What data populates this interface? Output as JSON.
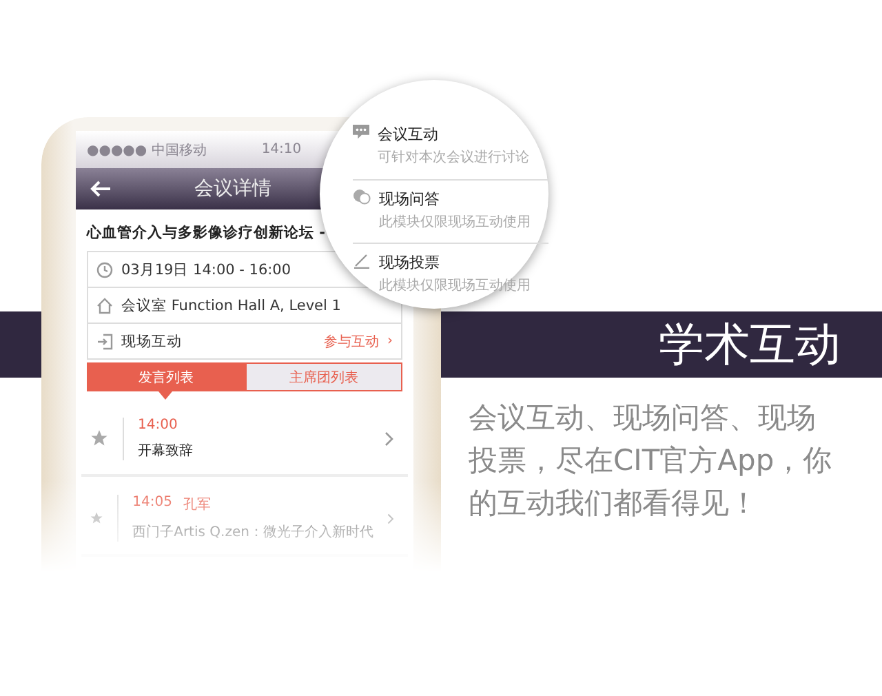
{
  "status_bar": {
    "carrier": "●●●●● 中国移动",
    "time": "14:10"
  },
  "nav": {
    "title": "会议详情"
  },
  "session": {
    "title": "心血管介入与多影像诊疗创新论坛 -"
  },
  "info_rows": [
    {
      "kind": "time",
      "text": "03月19日 14:00 - 16:00"
    },
    {
      "kind": "place",
      "text": "会议室 Function Hall A, Level 1"
    },
    {
      "kind": "interact",
      "text": "现场互动",
      "action": "参与互动",
      "chevron": "›"
    }
  ],
  "tabs": [
    {
      "label": "发言列表",
      "selected": true
    },
    {
      "label": "主席团列表",
      "selected": false
    }
  ],
  "talks": [
    {
      "time": "14:00",
      "title": "开幕致辞"
    },
    {
      "time": "14:05",
      "speaker": "孔军",
      "title": "西门子Artis Q.zen：微光子介入新时代"
    }
  ],
  "popup_items": [
    {
      "kind": "chat",
      "title": "会议互动",
      "subtitle": "可针对本次会议进行讨论"
    },
    {
      "kind": "qa",
      "title": "现场问答",
      "subtitle": "此模块仅限现场互动使用"
    },
    {
      "kind": "vote",
      "title": "现场投票",
      "subtitle": "此模块仅限现场互动使用"
    }
  ],
  "banner": {
    "title": "学术互动",
    "text": "会议互动、现场问答、现场投票，尽在CIT官方App，你的互动我们都看得见！"
  }
}
